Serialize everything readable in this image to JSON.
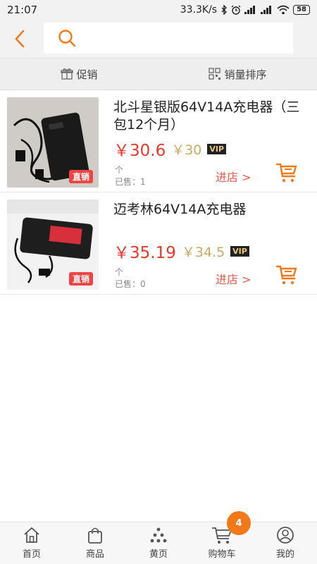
{
  "status_bar": {
    "time": "21:07",
    "net_speed": "33.3K/s",
    "battery": "58"
  },
  "header": {
    "search_placeholder": ""
  },
  "tabs": [
    {
      "label": "促销",
      "icon": "gift-icon"
    },
    {
      "label": "销量排序",
      "icon": "grid-icon"
    }
  ],
  "products": [
    {
      "title": "北斗星银版64V14A充电器（三包12个月）",
      "price": "￥30.6",
      "vip_price": "￥30",
      "vip_tag": "VIP",
      "unit": "个",
      "sold": "已售：1",
      "badge": "直销",
      "enter_store": "进店 >"
    },
    {
      "title": "迈考林64V14A充电器",
      "price": "￥35.19",
      "vip_price": "￥34.5",
      "vip_tag": "VIP",
      "unit": "个",
      "sold": "已售：0",
      "badge": "直销",
      "enter_store": "进店 >"
    }
  ],
  "tabbar": [
    {
      "label": "首页",
      "icon": "home-icon"
    },
    {
      "label": "商品",
      "icon": "bag-icon"
    },
    {
      "label": "黄页",
      "icon": "directory-icon"
    },
    {
      "label": "购物车",
      "icon": "cart-icon",
      "badge": "4"
    },
    {
      "label": "我的",
      "icon": "user-icon"
    }
  ],
  "colors": {
    "accent": "#f07a1a",
    "price": "#e6392b",
    "vip_price": "#c9a960",
    "store_link": "#e8574a"
  }
}
